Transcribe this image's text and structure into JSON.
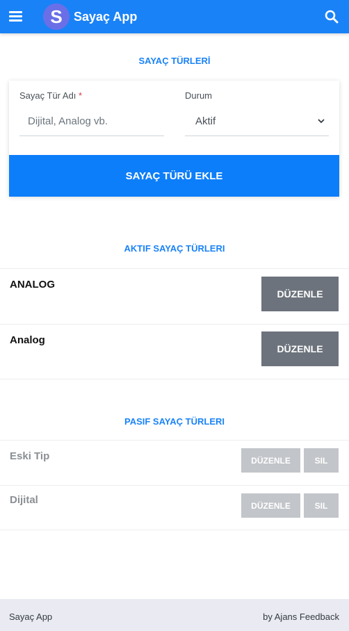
{
  "header": {
    "logo_letter": "S",
    "title": "Sayaç App"
  },
  "form": {
    "section_title": "SAYAÇ TÜRLERİ",
    "name_label": "Sayaç Tür Adı",
    "required_mark": "*",
    "name_placeholder": "Dijital, Analog vb.",
    "status_label": "Durum",
    "status_value": "Aktif",
    "add_button": "SAYAÇ TÜRÜ EKLE"
  },
  "active": {
    "title": "AKTIF SAYAÇ TÜRLERI",
    "items": [
      {
        "name": "ANALOG",
        "edit": "DÜZENLE"
      },
      {
        "name": "Analog",
        "edit": "DÜZENLE"
      }
    ]
  },
  "passive": {
    "title": "PASIF SAYAÇ TÜRLERI",
    "items": [
      {
        "name": "Eski Tip",
        "edit": "DÜZENLE",
        "delete": "SIL"
      },
      {
        "name": "Dijital",
        "edit": "DÜZENLE",
        "delete": "SIL"
      }
    ]
  },
  "footer": {
    "left": "Sayaç App",
    "right": "by Ajans Feedback"
  },
  "colors": {
    "primary": "#1a82f7",
    "button_dark": "#6c737c",
    "button_disabled": "#c2c5c9"
  }
}
